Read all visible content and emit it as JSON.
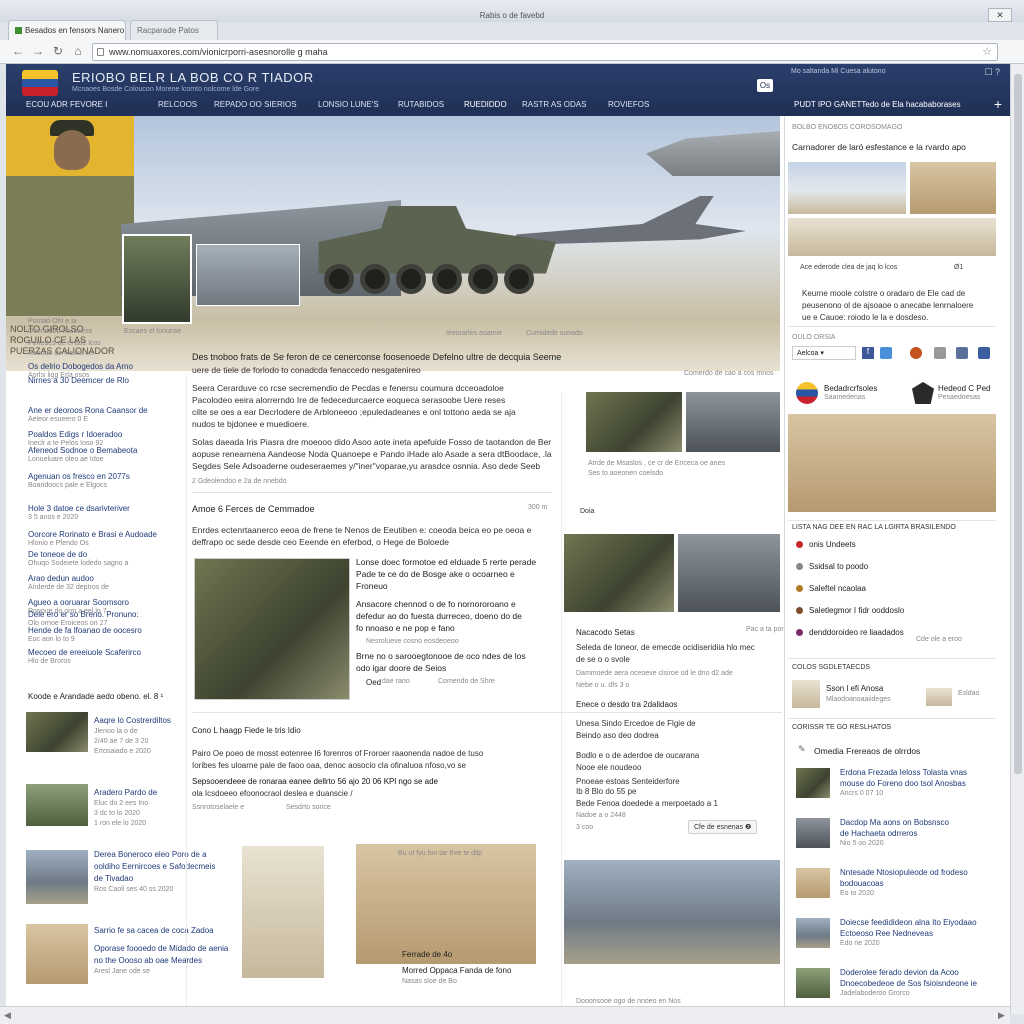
{
  "browser": {
    "window_title": "Rabis o de favebd",
    "tabs": [
      {
        "label": "Besados en fensors Nanero"
      },
      {
        "label": "Racparade Patos"
      }
    ],
    "url": "www.nomuaxores.com/vionicrporri-asesnorolle g maha",
    "nav": {
      "back": "←",
      "forward": "→",
      "reload": "↻",
      "home": "⌂"
    }
  },
  "site": {
    "title": "ERIOBO BELR LA BOB   CO R TIADOR",
    "subtitle": "Mcnaoes Bosde Coloucon Morene  lcomto nolcome lde Gore",
    "header_right": "Mo saltanda   Mi Cuesa   alutono",
    "header_icons": "☐ ?",
    "section_label": "ECOU ADR  FEVORE I",
    "nav_items": [
      "RELCOOS",
      "REPADO OO  SIERIOS",
      "LONSIO LUNE'S",
      "RUTABIDOS",
      "RUEDIDDO",
      "RASTR AS ODAS",
      "ROVIEFOS"
    ],
    "search_btn": "Os",
    "right_title": "PUDT IPO   GANETTedo de Ela hacababorases",
    "plus": "+"
  },
  "hero": {
    "left_caption": "NOLTO GIROLSO ROGUILO CE LAS PUERZAS CALIONADOR",
    "inset_caption": "Escaes el tonunse",
    "cap1": "Ieeorarles eoamie",
    "cap2": "Cumidede sunado",
    "cap3": "Comerdo de cao a cos mnos"
  },
  "left_col": {
    "meta1": "Pontad  Ofrl e la",
    "meta2": "Ocerstdoo hociaress",
    "meta3": "Ponedes  de el ade lcos",
    "meta4": "Reedoe de Reliss ee",
    "items": [
      {
        "title": "Os delrio Dobogedos da Arno",
        "sub": "Aorlsi ligg Erla osos"
      },
      {
        "title": "Nirnes a 30 Deemcer de Rlo",
        "sub": ""
      },
      {
        "title": "Ane er deoroos Rona Caansor de",
        "sub": "Aeleor esueero 0 E"
      },
      {
        "title": "Poaldos Edigs r Idoeradoo",
        "sub": "Ineclr a te Pelos Ioso 92"
      },
      {
        "title": "Afeneod Sodnoe o Bemabeota",
        "sub": "Lonueluare oleo ae Idoe"
      },
      {
        "title": "Agenuan os fresco en 2077s",
        "sub": "Boaridoocs pale e Elgocs"
      },
      {
        "title": "Hole 3 datoe ce dsarivteriver",
        "sub": "3 5 anos e 2020"
      },
      {
        "title": "Oorcore Rorinato e Brasi e Audoade",
        "sub": "Hlonio e Pfendo Os"
      },
      {
        "title": "De toneoe de do",
        "sub": "Ohuqo Sodeiete lodedo sagno a"
      },
      {
        "title": "Arao dedun audoo",
        "sub": "Anderde de 32 deptros de"
      },
      {
        "title": "Agueo a ooruarar Soomsoro",
        "sub": "Ronoue do orm a eel lo 7"
      },
      {
        "title": "Dele ero er so Breno. Pronuno:",
        "sub": "Olo ornoe Eroiceos on 27"
      },
      {
        "title": "Hende de fa lfoanao de oocesro",
        "sub": "Eoc aon lo to 9"
      },
      {
        "title": "Mecoeo de ereeiuole Scaferirco",
        "sub": "Hlo de Broros"
      }
    ],
    "footer": "Koode e Arandade aedo obeno. el. 8 ¹"
  },
  "left_thumbs": [
    {
      "title": "Aaqre lo Costrerdiltos",
      "line2": "Jlenoo la o de",
      "line3": "2/40 ae 7 de 3 20",
      "line4": "Ertosaiado e 2020"
    },
    {
      "title": "Aradero Pardo de",
      "line2": "Eluc do 2 ees Ino",
      "line3": "3 dc to lo 2020",
      "line4": "1 ron ele lo 2020"
    },
    {
      "title": "Derea Boneroco eleo Poro de a",
      "line2": "ooldiho Eernircoes e Safodecmeis",
      "line3": "de Tivadao",
      "line4": "Ros Caoli ses 40 ss 2020"
    },
    {
      "title": "Sarrio fe sa cacea de coca Zadoa",
      "line2": "Oporase foooedo de Midado de aenia",
      "line3": "no the Oooso ab oae Meardes",
      "line4": "Aresl Jane ode se"
    }
  ],
  "main": {
    "intro_lead": "Des tnoboo frats de Se feron de ce cenerconse foosenoede Defelno ultre de decquia Seeme",
    "intro_sub": "uere de tiele de forlodo to conadcda fenaccedo nesgatenireo",
    "para": [
      "Seera Cerarduve co rcse secremendio de Pecdas e fenersu coumura dcceoadoloe",
      "Pacolodeo eeira alorrerndo Ire de fedecedurcaerce eoqueca serasoobe Uere reses",
      "cilte se oes a ear Decrlodere de Arbloneeoo ;epuledadeanes e onl tottono aeda se aja",
      "nudos te bjdonee e muedioere."
    ],
    "para2": [
      "Solas daeada Iris Piasra dre moeooo dido Asoo aote ineta apefuide Fosso de taotandon de Ber",
      "aopuse renearnena Aandeose Noda Quanoepe e Pando iHade alo Asade a sera dtBoodace, .la",
      "Segdes Sele Adsoaderne oudeseraemes y/\"iner\"voparae,yu arasdce osnnia. Aso dede Seeb"
    ],
    "para_meta": "2 Gdeolendoo e 2a de nnebdo",
    "right_small_cap": "Atrde de Msaslos ,  ce cr de Enceca oe anes",
    "right_small_cap2": "Ses to aoeonen coelsdo",
    "article2_title": "Amoe 6 Ferces de Cemmadoe",
    "article2_time": "300 m",
    "article2_sub": "Enrdes ectenrtaanerco eeoa de frene te Nenos de Eeutiben e: coeoda beica eo pe oeoa e",
    "article2_sub2": "deffrapo oc sede   desde ceo Eeende en eferbod, o Hege de Boloede",
    "article2_side": "Doia",
    "caption_a1": "Lonse doec formotoe ed elduade 5 rerte perade",
    "caption_a2": "Pade te ce do de Bosge ake o ocoarneo e",
    "caption_a3": "Froneuo",
    "caption_b1": "Ansacore chennod o de fo nornororoano e",
    "caption_b2": "defedur ao do fuesta durreceo, doeno do de",
    "caption_b3": "fo nnoaso e ne pop e fano",
    "caption_c_meta": "Nesrolueve cosno  eosdeoeoo",
    "caption_d1": "Brne no o sarooegtonooe de oco ndes de los",
    "caption_d2": "odo igar doore de Seios",
    "caption_e_a": "Oed",
    "caption_e_b": "dae rano",
    "caption_e_c": "Comendo de Shre",
    "article3_title": "Cono L haagp Fiede le tris Idio",
    "article3_body": [
      "Pairo Oe poeo de mosst eotenree I6 forenros of Froroer raaonenda nadoe de tuso",
      "Ioribes fes uloarne pale de faoo oaa, denoc aosocio cla ofinaluoa nfoso,vo se",
      "Sepsooendeee de ronaraa eanee dellrto 56 ajo 20 06 KPl ngo se ade",
      "ola Icsdoeeo  efoonocraol deslea e duanscie /"
    ],
    "article3_meta1": "Ssnrotoselaele  e",
    "article3_meta2": "Sesdrto sonce",
    "mid_right_title": "Nacacodo Setas",
    "mid_right_tag": "Pac a ta por",
    "mid_right_body": [
      "Seleda de Ioneor, de emecde ocidiseridiia hlo mec",
      "de se o o svole"
    ],
    "mid_right_meta": "Dammoede aera oceoeve  clsiroe od le dno  d2 ade",
    "mid_right_meta2": "Nebe o u. dfs 3 o",
    "mid_right2_title": "Enece o desdo tra 2dalidaos",
    "mid_right2_lines": [
      "Unesa Sindo Ercedoe de Flgie de",
      "Beindo aso deo dodrea"
    ],
    "mid_right3_lines": [
      "Bodlo e o de aderdoe de oucarana",
      "Nooe ele noudeoo"
    ],
    "mid_right4_lines": [
      "Pnoeae estoas Senteiderfore",
      "Ib 8 Blo do 55 pe"
    ],
    "mid_right5": "Bede Fenoa doedede a merpoetado a 1",
    "mid_right5_meta": "Nadoe a o 2448",
    "mid_right5_sub": "3 coo",
    "more_btn": "Cfe de esnenas ❷",
    "gallery_caption1": "Ferrade de 4o",
    "gallery_caption2": "Morred Oppaca Fanda de fono",
    "gallery_caption3": "Nasas sloe  de Bo",
    "gallery_top_label": "Bu ut fyu fon tar thre te dilp",
    "bottom_right_caption": "Dooonsooe   ogo  de nnoeo  en Nos"
  },
  "sidebar": {
    "top_heading": "BOLBO ENOBOS COROSOMAGO",
    "lead": "Carnadorer de laró esfestance e la rvardo apo",
    "photo_caption": "Ace ederode clea de jaq lo lcos",
    "photo_caption2": "Ø1",
    "body": [
      "Keurne moole colstre o oradaro de Ele cad de",
      "peusenono ol de ajsoaoe o anecabe lenrnaloere",
      "ue e Cauoe: roiodo le la e dosdeso."
    ],
    "share_label": "OULO ORSIA",
    "share_select": "Aelcoa",
    "flags": [
      {
        "name": "Bedadrcrfsoles",
        "sub": "Saamedenas"
      },
      {
        "name": "Hedeod C Ped",
        "sub": "Pesaedoesas"
      }
    ],
    "section2": "LISTA NAG DEE EN RAC LA LGIRTA BRASILENDO",
    "list2": [
      {
        "text": "onis Undeets",
        "color": "#c8232c"
      },
      {
        "text": "Ssidsal to poodo",
        "color": "#888"
      },
      {
        "text": "Saleftel ncaolaa",
        "color": "#b07a26"
      },
      {
        "text": "Saletlegmor I fidr ooddoslo",
        "color": "#7a4b2a"
      },
      {
        "text": "denddoroideo re liaadados",
        "color": "#7a2a6a"
      }
    ],
    "list2_side": "Cde ole a eroo",
    "section3": "COLOS SGDLETAECDS",
    "promo_title": "Sson l efi Anosa",
    "promo_sub": "Mlaodoanoaaiideges",
    "promo_side": "Esldao",
    "section4": "CORISSR TE GO RESLHATOS",
    "edit_label": "Omedia Frereaos de olrrdos",
    "news": [
      {
        "t1": "Erdona Frezada Ieloss Tolasta vnas",
        "t2": "mouse do Foreno doo tsol Anosbas",
        "meta": "Ancrs 0 07 10"
      },
      {
        "t1": "Dacdop Ma aons on Bobsnsco",
        "t2": "de Hachaeta odrreros",
        "meta": "Nio 5 oo 2020"
      },
      {
        "t1": "Nntesade Ntosiopuleode od frodeso",
        "t2": "bodouacoas",
        "meta": "Eo to 2020"
      },
      {
        "t1": "Doiecse feedidideon alna Ito Eiyodaao",
        "t2": "Ectoeoso Ree Nedneveas",
        "meta": "Edo ne 2020"
      },
      {
        "t1": "Doderolee ferado devion da Acoo",
        "t2": "Dnoecobedeoe de Sos fsioisndeone ie",
        "meta": "Jadelaboderoo Grorco"
      }
    ]
  },
  "colors": {
    "header": "#1f2f55",
    "link": "#1f3a78",
    "accent_red": "#c8232c"
  }
}
